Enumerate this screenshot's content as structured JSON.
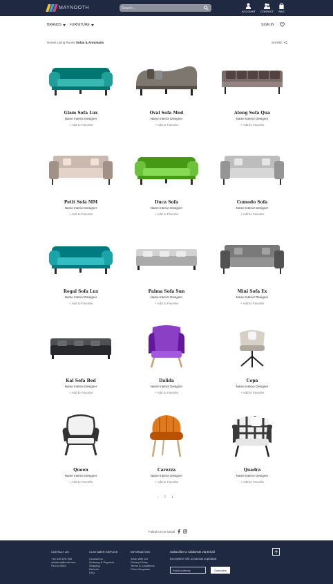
{
  "header": {
    "logo_text": "MAYNOOTH",
    "search_placeholder": "Search...",
    "account_label": "ACCOUNT",
    "contact_label": "CONTACT",
    "bag_label": "BAG"
  },
  "nav": {
    "brands_label": "BRANDS",
    "furniture_label": "FURNITURE",
    "signin_label": "SIGN IN"
  },
  "breadcrumb": {
    "path": "Home/ Living Room/",
    "current": "Sofas & Armchairs"
  },
  "share_label": "SHARE",
  "products": [
    {
      "name": "Glam Sofa Lux",
      "designer": "Name Interior Designer",
      "fav": "+ Add to Favorite",
      "color": "#1f9e9a",
      "shape": "chesterfield"
    },
    {
      "name": "Oval Sofa Mod",
      "designer": "Name Interior Designer",
      "fav": "+ Add to Favorite",
      "color": "#7d7770",
      "shape": "curved"
    },
    {
      "name": "Along Sofa Qua",
      "designer": "Name Interior Designer",
      "fav": "+ Add to Favorite",
      "color": "#7a6a68",
      "shape": "long"
    },
    {
      "name": "Petit Sofa MM",
      "designer": "Name Interior Designer",
      "fav": "+ Add to Favorite",
      "color": "#c9b9ae",
      "shape": "sofa"
    },
    {
      "name": "Duca Sofa",
      "designer": "Name Interior Designer",
      "fav": "+ Add to Favorite",
      "color": "#6cc23a",
      "shape": "chesterfield"
    },
    {
      "name": "Comodo Sofa",
      "designer": "Name Interior Designer",
      "fav": "+ Add to Favorite",
      "color": "#bdbdbd",
      "shape": "sofa"
    },
    {
      "name": "Regal Sofa Lux",
      "designer": "Name Interior Designer",
      "fav": "+ Add to Favorite",
      "color": "#1aa3a8",
      "shape": "chesterfield"
    },
    {
      "name": "Palma Sofa Sun",
      "designer": "Name Interior Designer",
      "fav": "+ Add to Favorite",
      "color": "#d2d2d2",
      "shape": "low"
    },
    {
      "name": "Mini Sofa Ex",
      "designer": "Name Interior Designer",
      "fav": "+ Add to Favorite",
      "color": "#7a7a7a",
      "shape": "sofa"
    },
    {
      "name": "Kal Sofa Bed",
      "designer": "Name Interior Designer",
      "fav": "+ Add to Favorite",
      "color": "#4e5054",
      "shape": "low"
    },
    {
      "name": "Dalida",
      "designer": "Name Interior Designer",
      "fav": "+ Add to Favorite",
      "color": "#8a3fc4",
      "shape": "wingchair"
    },
    {
      "name": "Copa",
      "designer": "Name Interior Designer",
      "fav": "+ Add to Favorite",
      "color": "#d6d0c6",
      "shape": "swivel"
    },
    {
      "name": "Queen",
      "designer": "Name Interior Designer",
      "fav": "+ Add to Favorite",
      "color": "#f2f2f2",
      "shape": "queen"
    },
    {
      "name": "Carezza",
      "designer": "Name Interior Designer",
      "fav": "+ Add to Favorite",
      "color": "#e07a1e",
      "shape": "shell"
    },
    {
      "name": "Quadra",
      "designer": "Name Interior Designer",
      "fav": "+ Add to Favorite",
      "color": "#3a3a3a",
      "shape": "plaid"
    }
  ],
  "pagination": {
    "prev": "‹",
    "page": "2",
    "next": "›"
  },
  "follow_label": "Follow us on social",
  "footer": {
    "contact": {
      "title": "CONTACT US",
      "lines": [
        "+44 345 678 903",
        "adobexd@mail.com",
        "Find a Store"
      ]
    },
    "service": {
      "title": "CUSTOMER SERVICE",
      "lines": [
        "Contact Us",
        "Ordering & Payment",
        "Shipping",
        "Returns",
        "FAQ"
      ]
    },
    "info": {
      "title": "INFORMATION",
      "lines": [
        "Work With US",
        "Privacy Policy",
        "Terms & Conditions",
        "Press Enquiries"
      ]
    },
    "subscribe_title": "Subscribe to AdobeXD via Email",
    "subscribe_text": "Excepteur sint occaecat cupidatat",
    "email_placeholder": "Email Address",
    "subscribe_button": "Subscribe"
  }
}
